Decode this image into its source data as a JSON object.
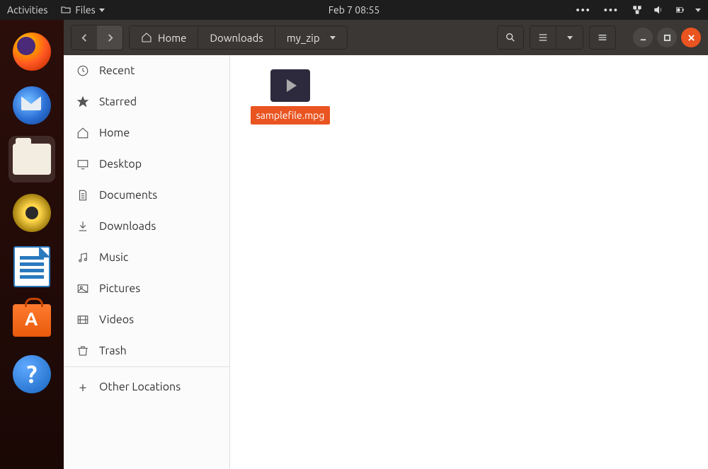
{
  "topbar": {
    "activities": "Activities",
    "app_label": "Files",
    "clock": "Feb 7  08:55"
  },
  "breadcrumb": {
    "home": "Home",
    "downloads": "Downloads",
    "current": "my_zip"
  },
  "sidebar": {
    "items": [
      {
        "label": "Recent"
      },
      {
        "label": "Starred"
      },
      {
        "label": "Home"
      },
      {
        "label": "Desktop"
      },
      {
        "label": "Documents"
      },
      {
        "label": "Downloads"
      },
      {
        "label": "Music"
      },
      {
        "label": "Pictures"
      },
      {
        "label": "Videos"
      },
      {
        "label": "Trash"
      }
    ],
    "other": "Other Locations"
  },
  "files": [
    {
      "name": "samplefile.mpg"
    }
  ]
}
